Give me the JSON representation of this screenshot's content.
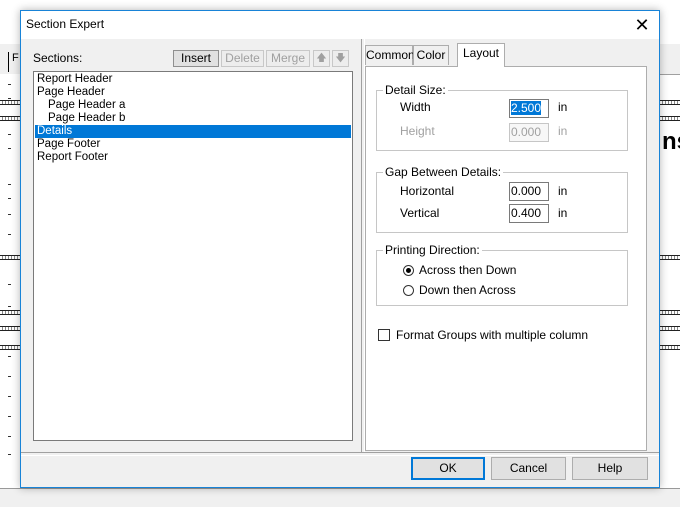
{
  "dialog": {
    "title": "Section Expert",
    "close_glyph": "✕"
  },
  "background": {
    "tab_label": "F",
    "right_text": "ns"
  },
  "sections": {
    "label": "Sections:",
    "buttons": {
      "insert": "Insert",
      "delete": "Delete",
      "merge": "Merge",
      "move_up": "🡅",
      "move_down": "🡇"
    },
    "items": [
      "Report Header",
      "Page Header",
      "Page Header a",
      "Page Header b",
      "Details",
      "Page Footer",
      "Report Footer"
    ],
    "selected": "Details"
  },
  "tabs": [
    "Common",
    "Color",
    "Layout"
  ],
  "active_tab": "Layout",
  "layout": {
    "detail_size": {
      "title": "Detail Size:",
      "width_label": "Width",
      "width_value": "2.500",
      "width_unit": "in",
      "height_label": "Height",
      "height_value": "0.000",
      "height_unit": "in"
    },
    "gap": {
      "title": "Gap Between Details:",
      "horizontal_label": "Horizontal",
      "horizontal_value": "0.000",
      "horizontal_unit": "in",
      "vertical_label": "Vertical",
      "vertical_value": "0.400",
      "vertical_unit": "in"
    },
    "direction": {
      "title": "Printing Direction:",
      "option1": "Across then Down",
      "option2": "Down then Across",
      "selected": "Across then Down"
    },
    "format_groups_label": "Format Groups with multiple column",
    "format_groups_checked": false
  },
  "footer": {
    "ok": "OK",
    "cancel": "Cancel",
    "help": "Help"
  },
  "colors": {
    "selection": "#0078d7",
    "dialog_bg": "#f0f0f0",
    "border_accent": "#1883d7"
  }
}
